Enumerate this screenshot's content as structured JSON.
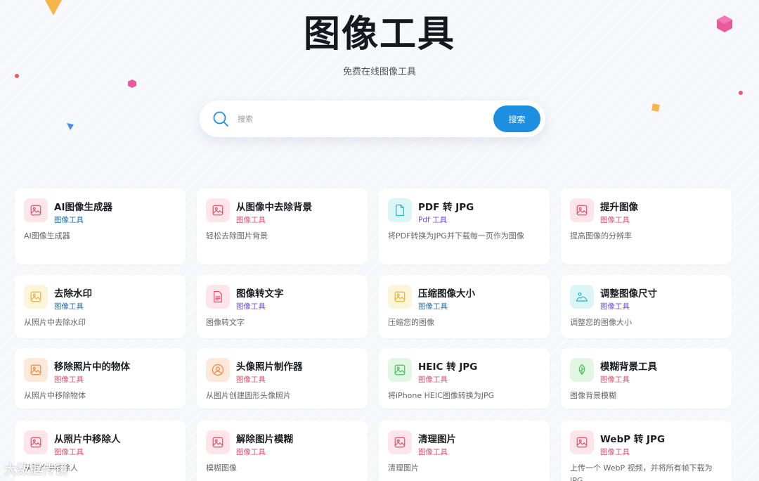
{
  "hero": {
    "title": "图像工具",
    "subtitle": "免费在线图像工具"
  },
  "search": {
    "placeholder": "搜索",
    "button_label": "搜索"
  },
  "tools": [
    {
      "title": "AI图像生成器",
      "category": "图像工具",
      "category_color": "#1a6fa8",
      "description": "AI图像生成器",
      "icon": "image-icon",
      "icon_color": "#e0506e",
      "icon_bg": "#fde5ea"
    },
    {
      "title": "从图像中去除背景",
      "category": "图像工具",
      "category_color": "#e0506e",
      "description": "轻松去除图片背景",
      "icon": "image-icon",
      "icon_color": "#e0506e",
      "icon_bg": "#fde5ea"
    },
    {
      "title": "PDF 转 JPG",
      "category": "Pdf 工具",
      "category_color": "#6b4fd6",
      "description": "将PDF转换为JPG并下载每一页作为图像",
      "icon": "document-icon",
      "icon_color": "#22b8c8",
      "icon_bg": "#dcf6f8"
    },
    {
      "title": "提升图像",
      "category": "图像工具",
      "category_color": "#e0506e",
      "description": "提高图像的分辨率",
      "icon": "image-icon",
      "icon_color": "#e0506e",
      "icon_bg": "#fde5ea"
    },
    {
      "title": "去除水印",
      "category": "图像工具",
      "category_color": "#2a6fb0",
      "description": "从照片中去除水印",
      "icon": "image-icon",
      "icon_color": "#e3b23a",
      "icon_bg": "#fdf5d9"
    },
    {
      "title": "图像转文字",
      "category": "图像工具",
      "category_color": "#6b4fd6",
      "description": "图像转文字",
      "icon": "text-document-icon",
      "icon_color": "#e0506e",
      "icon_bg": "#fde5ea"
    },
    {
      "title": "压缩图像大小",
      "category": "图像工具",
      "category_color": "#2a6fb0",
      "description": "压缩您的图像",
      "icon": "image-icon",
      "icon_color": "#e3b23a",
      "icon_bg": "#fdf5d9"
    },
    {
      "title": "调整图像尺寸",
      "category": "图像工具",
      "category_color": "#6b4fd6",
      "description": "调整您的图像大小",
      "icon": "landscape-icon",
      "icon_color": "#22b8c8",
      "icon_bg": "#dcf6f8"
    },
    {
      "title": "移除照片中的物体",
      "category": "图像工具",
      "category_color": "#e0506e",
      "description": "从照片中移除物体",
      "icon": "image-icon",
      "icon_color": "#ee8a3c",
      "icon_bg": "#fde9d9"
    },
    {
      "title": "头像照片制作器",
      "category": "图像工具",
      "category_color": "#e0506e",
      "description": "从图片创建圆形头像照片",
      "icon": "avatar-icon",
      "icon_color": "#ee8a3c",
      "icon_bg": "#fde9d9"
    },
    {
      "title": "HEIC 转 JPG",
      "category": "图像工具",
      "category_color": "#e0506e",
      "description": "将iPhone HEIC图像转换为JPG",
      "icon": "image-icon",
      "icon_color": "#4cbf5a",
      "icon_bg": "#e2f6e4"
    },
    {
      "title": "模糊背景工具",
      "category": "图像工具",
      "category_color": "#e0506e",
      "description": "图像背景模糊",
      "icon": "leaf-icon",
      "icon_color": "#4cbf5a",
      "icon_bg": "#e2f6e4"
    },
    {
      "title": "从照片中移除人",
      "category": "图像工具",
      "category_color": "#e0506e",
      "description": "从照片中移除人",
      "icon": "image-icon",
      "icon_color": "#e0506e",
      "icon_bg": "#fde5ea"
    },
    {
      "title": "解除图片模糊",
      "category": "图像工具",
      "category_color": "#e0506e",
      "description": "模糊图像",
      "icon": "image-icon",
      "icon_color": "#e0506e",
      "icon_bg": "#fde5ea"
    },
    {
      "title": "清理图片",
      "category": "图像工具",
      "category_color": "#e0506e",
      "description": "清理图片",
      "icon": "image-icon",
      "icon_color": "#e0506e",
      "icon_bg": "#fde5ea"
    },
    {
      "title": "WebP 转 JPG",
      "category": "图像工具",
      "category_color": "#e0506e",
      "description": "上传一个 WebP 视频，并将所有帧下载为 JPG",
      "icon": "image-icon",
      "icon_color": "#e0506e",
      "icon_bg": "#fde5ea"
    }
  ],
  "watermark": "大数据传镜"
}
